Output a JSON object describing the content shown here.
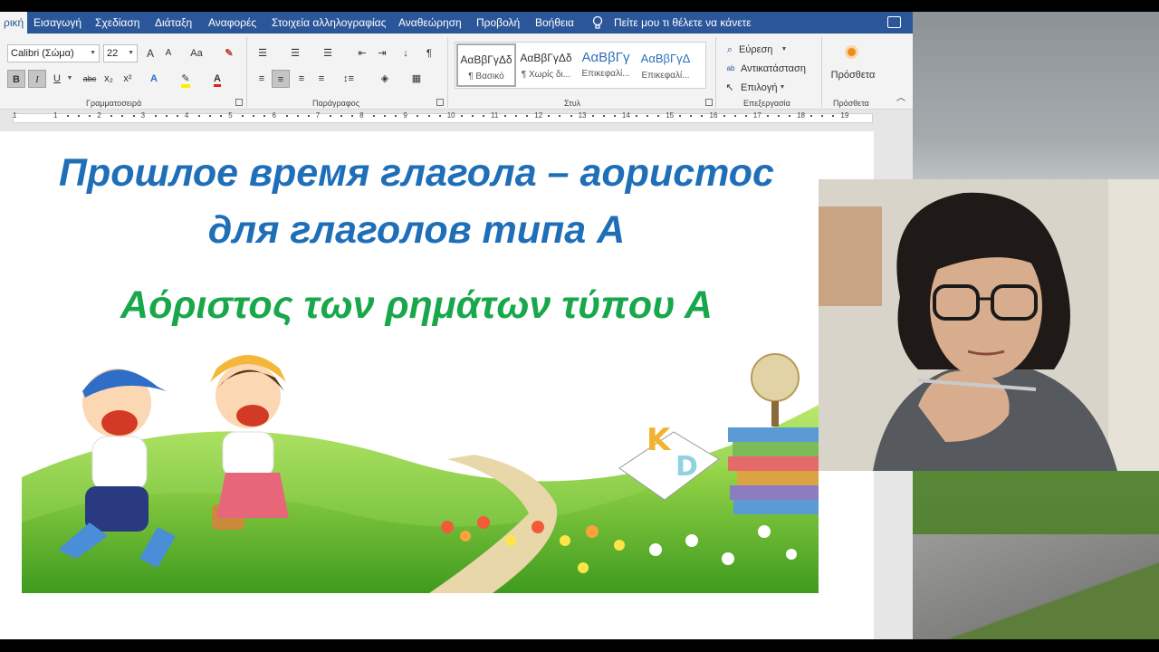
{
  "ribbon_tabs": [
    "ρική",
    "Εισαγωγή",
    "Σχεδίαση",
    "Διάταξη",
    "Αναφορές",
    "Στοιχεία αλληλογραφίας",
    "Αναθεώρηση",
    "Προβολή",
    "Βοήθεια"
  ],
  "tell_me": "Πείτε μου τι θέλετε να κάνετε",
  "font": {
    "name": "Calibri (Σώμα)",
    "size": "22"
  },
  "font_buttons": {
    "grow": "A",
    "shrink": "A",
    "case": "Aa",
    "bold": "B",
    "italic": "I",
    "underline": "U",
    "strike": "abc",
    "subscript": "x₂",
    "superscript": "x²"
  },
  "groups": {
    "font": "Γραμματοσειρά",
    "paragraph": "Παράγραφος",
    "styles": "Στυλ",
    "editing": "Επεξεργασία",
    "addins": "Πρόσθετα"
  },
  "styles": [
    {
      "sample": "ΑαΒβΓγΔδ",
      "name": "¶ Βασικό"
    },
    {
      "sample": "ΑαΒβΓγΔδ",
      "name": "¶ Χωρίς δι..."
    },
    {
      "sample": "ΑαΒβΓγ",
      "name": "Επικεφαλί..."
    },
    {
      "sample": "ΑαΒβΓγΔ",
      "name": "Επικεφαλί..."
    }
  ],
  "editing": {
    "find": "Εύρεση",
    "replace": "Αντικατάσταση",
    "select": "Επιλογή"
  },
  "addins_button": "Πρόσθετα",
  "ruler_numbers": [
    "1",
    "1",
    "2",
    "3",
    "4",
    "5",
    "6",
    "7",
    "8",
    "9",
    "10",
    "11",
    "12",
    "13",
    "14",
    "15",
    "16",
    "17",
    "18",
    "19"
  ],
  "document": {
    "title_ru_line1": "Прошлое время глагола – аористос",
    "title_ru_line2": "для глаголов типа А",
    "title_gr": "Αόριστος των ρημάτων  τύπου Α"
  },
  "colors": {
    "word_blue": "#2b579a",
    "title_blue": "#1f6fb8",
    "title_green": "#18a84b"
  }
}
